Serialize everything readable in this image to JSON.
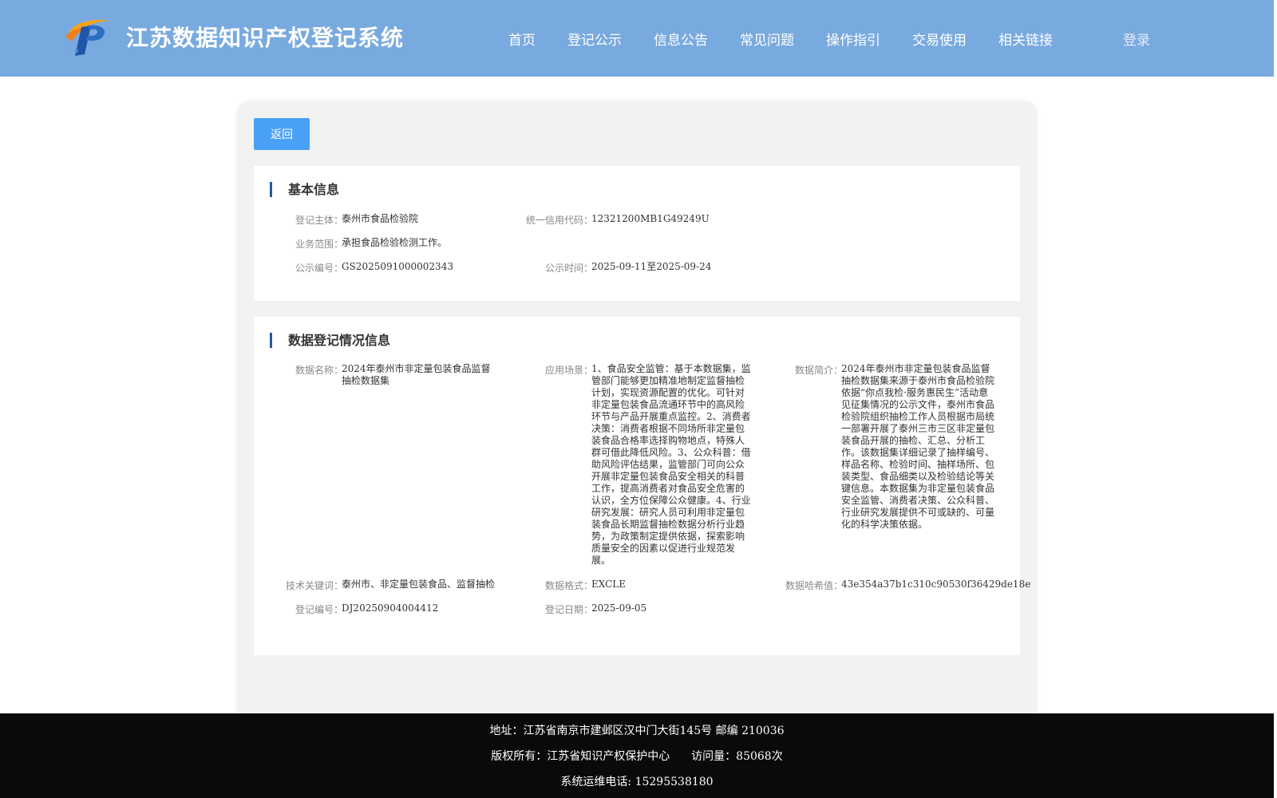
{
  "header": {
    "title": "江苏数据知识产权登记系统",
    "nav": [
      "首页",
      "登记公示",
      "信息公告",
      "常见问题",
      "操作指引",
      "交易使用",
      "相关链接"
    ],
    "login": "登录"
  },
  "back_label": "返回",
  "basic": {
    "title": "基本信息",
    "subject_label": "登记主体：",
    "subject": "泰州市食品检验院",
    "credit_label": "统一信用代码：",
    "credit": "12321200MB1G49249U",
    "scope_label": "业务范围：",
    "scope": "承担食品检验检测工作。",
    "pub_no_label": "公示编号：",
    "pub_no": "GS2025091000002343",
    "pub_time_label": "公示时间：",
    "pub_time": "2025-09-11至2025-09-24"
  },
  "reg": {
    "title": "数据登记情况信息",
    "name_label": "数据名称：",
    "name": "2024年泰州市非定量包装食品监督抽检数据集",
    "scene_label": "应用场景：",
    "scene": "1、食品安全监管：基于本数据集，监管部门能够更加精准地制定监督抽检计划，实现资源配置的优化。可针对非定量包装食品流通环节中的高风险环节与产品开展重点监控。2、消费者决策：消费者根据不同场所非定量包装食品合格率选择购物地点，特殊人群可借此降低风险。3、公众科普：借助风险评估结果，监管部门可向公众开展非定量包装食品安全相关的科普工作，提高消费者对食品安全危害的认识，全方位保障公众健康。4、行业研究发展：研究人员可利用非定量包装食品长期监督抽检数据分析行业趋势，为政策制定提供依据，探索影响质量安全的因素以促进行业规范发展。",
    "intro_label": "数据简介：",
    "intro": "2024年泰州市非定量包装食品监督抽检数据集来源于泰州市食品检验院依据“你点我检·服务惠民生”活动意见征集情况的公示文件，泰州市食品检验院组织抽检工作人员根据市局统一部署开展了泰州三市三区非定量包装食品开展的抽检、汇总、分析工作。该数据集详细记录了抽样编号、样品名称、检验时间、抽样场所、包装类型、食品细类以及检验结论等关键信息。本数据集为非定量包装食品安全监管、消费者决策、公众科普、行业研究发展提供不可或缺的、可量化的科学决策依据。",
    "keywords_label": "技术关键词：",
    "keywords": "泰州市、非定量包装食品、监督抽检",
    "format_label": "数据格式：",
    "format": "EXCLE",
    "hash_label": "数据哈希值：",
    "hash": "43e354a37b1c310c90530f36429de18e",
    "reg_no_label": "登记编号：",
    "reg_no": "DJ20250904004412",
    "reg_date_label": "登记日期：",
    "reg_date": "2025-09-05"
  },
  "footer": {
    "address": "地址：江苏省南京市建邺区汉中门大街145号 邮编 210036",
    "copyright": "版权所有：江苏省知识产权保护中心",
    "visits": "访问量：85068次",
    "phone": "系统运维电话: 15295538180"
  }
}
